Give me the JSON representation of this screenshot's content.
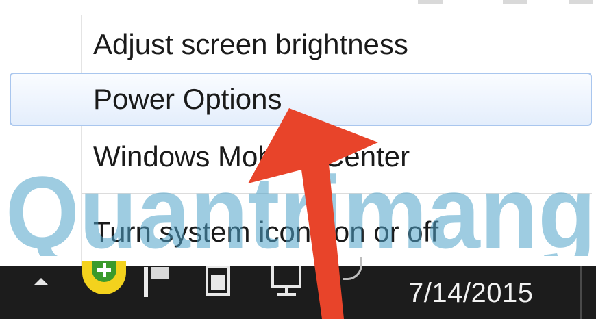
{
  "context_menu": {
    "items": [
      {
        "label": "Adjust screen brightness"
      },
      {
        "label": "Power Options"
      },
      {
        "label": "Windows Mobility Center"
      },
      {
        "label": "Turn system icons on or off"
      }
    ],
    "highlighted_item": "Power Options"
  },
  "taskbar": {
    "date": "7/14/2015",
    "tray_icons": [
      "show-hidden-icons-arrow",
      "green-plus-app-icon",
      "action-center-flag-icon",
      "battery-power-icon",
      "network-icon",
      "volume-icon"
    ]
  },
  "watermark": {
    "text": "Quantrimang"
  },
  "annotation": {
    "arrow_color": "#e8442a",
    "points_to": "Power Options"
  },
  "colors": {
    "highlight_border": "#a9c6ee",
    "taskbar_bg": "#1c1c1c",
    "watermark": "#4fa3c8"
  }
}
